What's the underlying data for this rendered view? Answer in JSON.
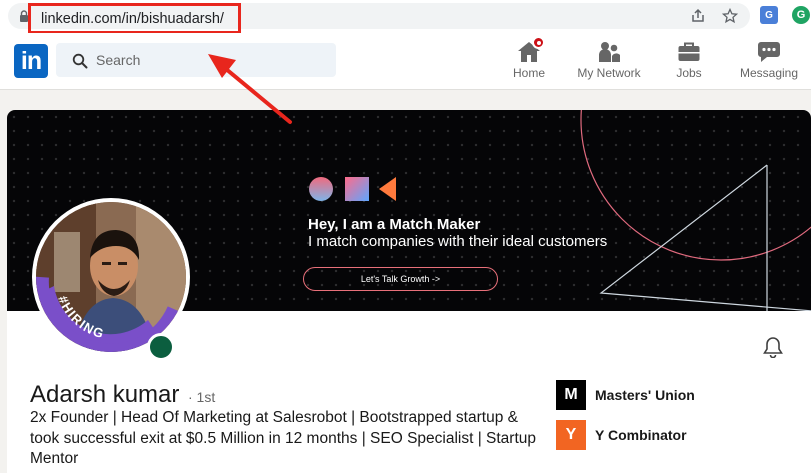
{
  "browser": {
    "url": "linkedin.com/in/bishuadarsh/",
    "translate_label": "G",
    "extension_label": "G"
  },
  "nav": {
    "logo": "in",
    "search_placeholder": "Search",
    "items": [
      {
        "label": "Home",
        "icon": "home-icon"
      },
      {
        "label": "My Network",
        "icon": "people-icon"
      },
      {
        "label": "Jobs",
        "icon": "briefcase-icon"
      },
      {
        "label": "Messaging",
        "icon": "chat-icon"
      }
    ]
  },
  "banner": {
    "headline_bold": "Hey, I am a Match Maker",
    "headline_sub": "I match companies with their ideal customers",
    "cta_label": "Let's Talk Growth ->"
  },
  "profile": {
    "hiring_badge": "#HIRING",
    "name": "Adarsh kumar",
    "degree": "· 1st",
    "headline": "2x Founder | Head Of Marketing at Salesrobot | Bootstrapped startup & took successful exit at $0.5 Million in 12 months | SEO Specialist | Startup Mentor",
    "orgs": [
      {
        "name": "Masters' Union",
        "logo_text": "M",
        "logo_color": "#000000"
      },
      {
        "name": "Y Combinator",
        "logo_text": "Y",
        "logo_color": "#f26522"
      }
    ]
  },
  "colors": {
    "linkedin_blue": "#0a66c2",
    "annotation_red": "#e8261d",
    "online_green": "#0b5e3f",
    "hiring_purple": "#7a4fc9"
  }
}
